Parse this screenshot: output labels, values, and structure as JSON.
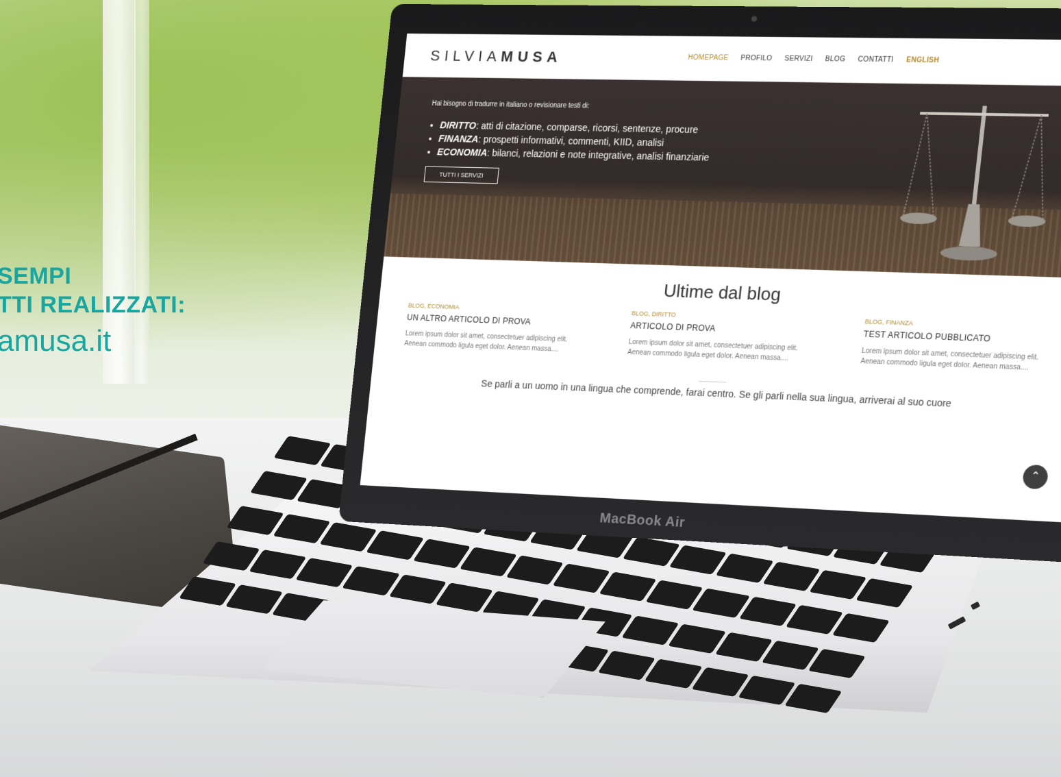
{
  "promo": {
    "line1": "SEMPI",
    "line2": "TTI REALIZZATI:",
    "url": "amusa.it"
  },
  "laptop": {
    "brand": "MacBook Air"
  },
  "site": {
    "logo_light": "SILVIA",
    "logo_bold": "MUSA",
    "nav": [
      {
        "label": "HOMEPAGE",
        "active": true
      },
      {
        "label": "PROFILO"
      },
      {
        "label": "SERVIZI"
      },
      {
        "label": "BLOG"
      },
      {
        "label": "CONTATTI"
      }
    ],
    "lang_link": "ENGLISH",
    "search_icon": "search-icon"
  },
  "hero": {
    "intro": "Hai bisogno di tradurre in italiano o revisionare testi di:",
    "items": [
      {
        "bold": "DIRITTO",
        "text": ": atti di citazione, comparse, ricorsi, sentenze, procure"
      },
      {
        "bold": "FINANZA",
        "text": ": prospetti informativi, commenti, KIID, analisi"
      },
      {
        "bold": "ECONOMIA",
        "text": ": bilanci, relazioni e note integrative, analisi finanziarie"
      }
    ],
    "button": "TUTTI I SERVIZI"
  },
  "blog": {
    "title": "Ultime dal blog",
    "posts": [
      {
        "category": "BLOG, ECONOMIA",
        "title": "UN ALTRO ARTICOLO DI PROVA",
        "excerpt": "Lorem ipsum dolor sit amet, consectetuer adipiscing elit. Aenean commodo ligula eget dolor. Aenean massa...."
      },
      {
        "category": "BLOG, DIRITTO",
        "title": "ARTICOLO DI PROVA",
        "excerpt": "Lorem ipsum dolor sit amet, consectetuer adipiscing elit. Aenean commodo ligula eget dolor. Aenean massa...."
      },
      {
        "category": "BLOG, FINANZA",
        "title": "TEST ARTICOLO PUBBLICATO",
        "excerpt": "Lorem ipsum dolor sit amet, consectetuer adipiscing elit. Aenean commodo ligula eget dolor. Aenean massa...."
      }
    ],
    "quote": "Se parli a un uomo in una lingua che comprende, farai centro. Se gli parli nella sua lingua, arriverai al suo cuore",
    "scroll_icon": "chevron-up-icon"
  }
}
